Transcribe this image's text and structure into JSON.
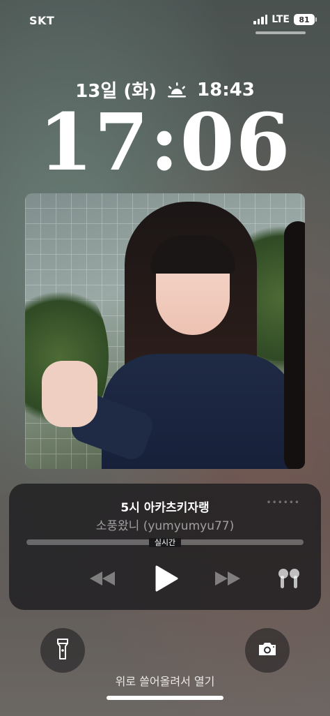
{
  "status_bar": {
    "carrier": "SKT",
    "network": "LTE",
    "battery": "81"
  },
  "lockscreen": {
    "date": "13일 (화)",
    "sunset_time": "18:43",
    "time": "17:06",
    "unlock_hint": "위로 쓸어올려서 열기"
  },
  "now_playing": {
    "title": "5시 아카츠키자랭",
    "artist": "소풍왔니 (yumyumyu77)",
    "live_label": "실시간"
  },
  "icons": {
    "sunset": "sunset-icon",
    "flashlight": "flashlight-icon",
    "camera": "camera-icon",
    "airpods": "airpods-icon",
    "rewind": "rewind-icon",
    "play": "play-icon",
    "forward": "fast-forward-icon"
  }
}
